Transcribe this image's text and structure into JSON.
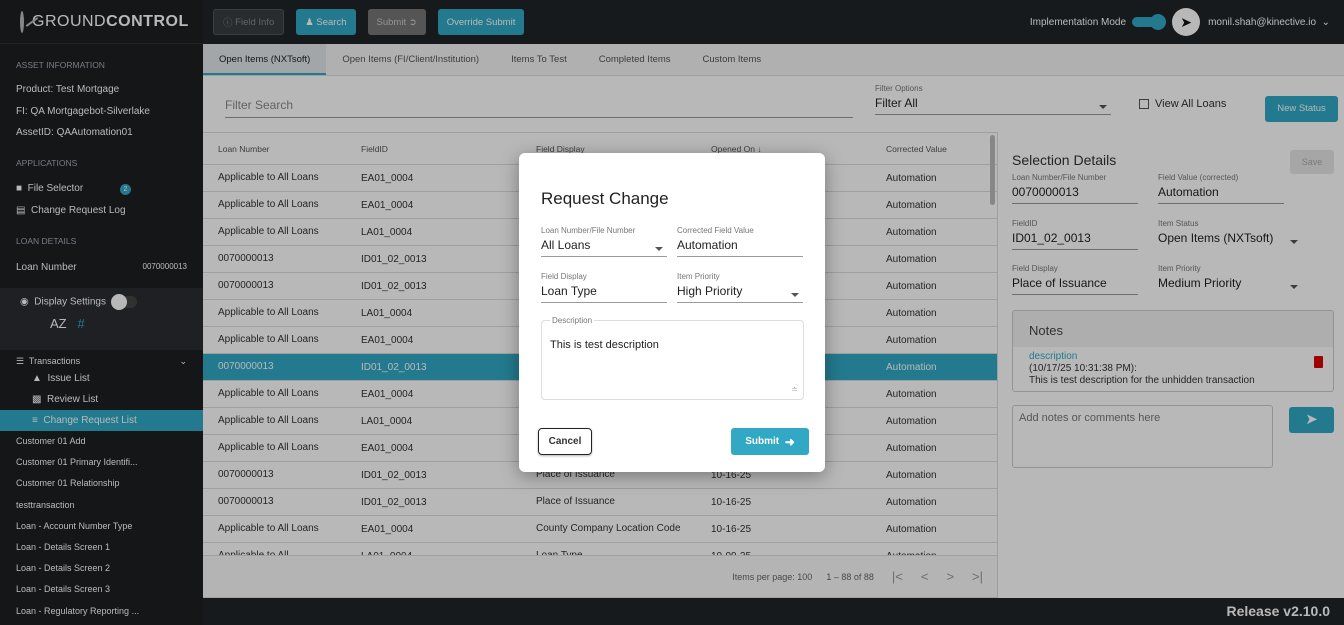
{
  "sidebar": {
    "logo_light": "GROUND",
    "logo_bold": "CONTROL",
    "asset_info": "ASSET INFORMATION",
    "product": "Product:  Test Mortgage",
    "fi": "FI:  QA Mortgagebot-Silverlake",
    "asset_id": "AssetID:  QAAutomation01",
    "applications": "APPLICATIONS",
    "file_selector": "File Selector",
    "file_selector_badge": "2",
    "change_request_log": "Change Request Log",
    "loan_details": "LOAN DETAILS",
    "loan_number_label": "Loan Number",
    "loan_number_value": "0070000013",
    "display_settings": "Display Settings",
    "az": "AZ",
    "hash": "#",
    "transactions": "Transactions",
    "issue_list": "Issue List",
    "review_list": "Review List",
    "change_request_list": "Change Request List",
    "items": [
      "Customer 01 Add",
      "Customer 01 Primary Identifi...",
      "Customer 01 Relationship",
      "testtransaction",
      "Loan - Account Number Type",
      "Loan - Details Screen 1",
      "Loan - Details Screen 2",
      "Loan - Details Screen 3",
      "Loan - Regulatory Reporting ..."
    ]
  },
  "topbar": {
    "field_info": "Field Info",
    "search": "Search",
    "submit": "Submit",
    "override_submit": "Override Submit",
    "implementation_mode": "Implementation Mode",
    "user_email": "monil.shah@kinective.io"
  },
  "tabs": [
    "Open Items (NXTsoft)",
    "Open Items (FI/Client/Institution)",
    "Items To Test",
    "Completed Items",
    "Custom Items"
  ],
  "filter": {
    "search_placeholder": "Filter Search",
    "options_label": "Filter Options",
    "options_value": "Filter All",
    "view_all_loans": "View All Loans",
    "new_status": "New Status"
  },
  "table": {
    "headers": [
      "Loan Number",
      "FieldID",
      "Field Display",
      "Opened On",
      "Corrected Value"
    ],
    "rows": [
      [
        "Applicable to All Loans",
        "EA01_0004",
        "",
        "",
        "Automation"
      ],
      [
        "Applicable to All Loans",
        "EA01_0004",
        "",
        "",
        "Automation"
      ],
      [
        "Applicable to All Loans",
        "LA01_0004",
        "",
        "",
        "Automation"
      ],
      [
        "0070000013",
        "ID01_02_0013",
        "",
        "",
        "Automation"
      ],
      [
        "0070000013",
        "ID01_02_0013",
        "",
        "",
        "Automation"
      ],
      [
        "Applicable to All Loans",
        "LA01_0004",
        "",
        "",
        "Automation"
      ],
      [
        "Applicable to All Loans",
        "EA01_0004",
        "",
        "",
        "Automation"
      ],
      [
        "0070000013",
        "ID01_02_0013",
        "",
        "",
        "Automation"
      ],
      [
        "Applicable to All Loans",
        "EA01_0004",
        "",
        "",
        "Automation"
      ],
      [
        "Applicable to All Loans",
        "LA01_0004",
        "",
        "",
        "Automation"
      ],
      [
        "Applicable to All Loans",
        "EA01_0004",
        "",
        "",
        "Automation"
      ],
      [
        "0070000013",
        "ID01_02_0013",
        "Place of Issuance",
        "10-16-25",
        "Automation"
      ],
      [
        "0070000013",
        "ID01_02_0013",
        "Place of Issuance",
        "10-16-25",
        "Automation"
      ],
      [
        "Applicable to All Loans",
        "EA01_0004",
        "County Company Location Code",
        "10-16-25",
        "Automation"
      ],
      [
        "Applicable to All",
        "LA01_0004",
        "Loan Type",
        "10-09-25",
        "Automation"
      ]
    ],
    "items_per_page": "Items per page: 100",
    "range": "1 – 88 of 88"
  },
  "details": {
    "title": "Selection Details",
    "save": "Save",
    "loan_label": "Loan Number/File Number",
    "loan_value": "0070000013",
    "fv_label": "Field Value (corrected)",
    "fv_value": "Automation",
    "fieldid_label": "FieldID",
    "fieldid_value": "ID01_02_0013",
    "status_label": "Item Status",
    "status_value": "Open Items (NXTsoft)",
    "fd_label": "Field Display",
    "fd_value": "Place of Issuance",
    "prio_label": "Item Priority",
    "prio_value": "Medium Priority",
    "notes_title": "Notes",
    "note_link": "description",
    "note_time": "(10/17/25 10:31:38 PM):",
    "note_text": "This is test description for the unhidden transaction",
    "comment_placeholder": "Add notes or comments here"
  },
  "footer": {
    "release": "Release v2.10.0"
  },
  "modal": {
    "title": "Request Change",
    "loan_label": "Loan Number/File Number",
    "loan_value": "All Loans",
    "cfv_label": "Corrected Field Value",
    "cfv_value": "Automation",
    "fd_label": "Field Display",
    "fd_value": "Loan Type",
    "prio_label": "Item Priority",
    "prio_value": "High Priority",
    "desc_label": "Description",
    "desc_value": "This is test description",
    "cancel": "Cancel",
    "submit": "Submit"
  }
}
